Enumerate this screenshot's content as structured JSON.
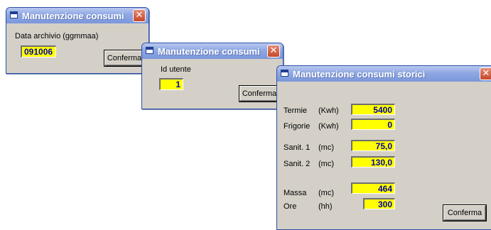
{
  "window1": {
    "title": "Manutenzione consumi",
    "close_glyph": "✕",
    "label": "Data archivio (ggmmaa)",
    "value": "091006",
    "button": "Conferma"
  },
  "window2": {
    "title": "Manutenzione consumi",
    "close_glyph": "✕",
    "label": "Id utente",
    "value": "1",
    "button": "Conferma"
  },
  "window3": {
    "title": "Manutenzione consumi storici",
    "close_glyph": "✕",
    "rows": [
      {
        "label": "Termie",
        "unit": "(Kwh)",
        "value": "5400"
      },
      {
        "label": "Frigorie",
        "unit": "(Kwh)",
        "value": "0"
      },
      {
        "label": "Sanit. 1",
        "unit": "(mc)",
        "value": "75,0"
      },
      {
        "label": "Sanit. 2",
        "unit": "(mc)",
        "value": "130,0"
      },
      {
        "label": "Massa",
        "unit": "(mc)",
        "value": "464"
      },
      {
        "label": "Ore",
        "unit": "(hh)",
        "value": "300"
      }
    ],
    "button": "Conferma"
  },
  "colors": {
    "title_gradient_top": "#b9c9f0",
    "title_gradient_bottom": "#7b97db",
    "field_bg": "#ffff00",
    "field_text": "#0000aa",
    "close_button": "#c7472b",
    "window_bg": "#d4d0c8"
  },
  "icons": {
    "window_icon": "app-window-icon",
    "close_icon": "close-icon"
  }
}
